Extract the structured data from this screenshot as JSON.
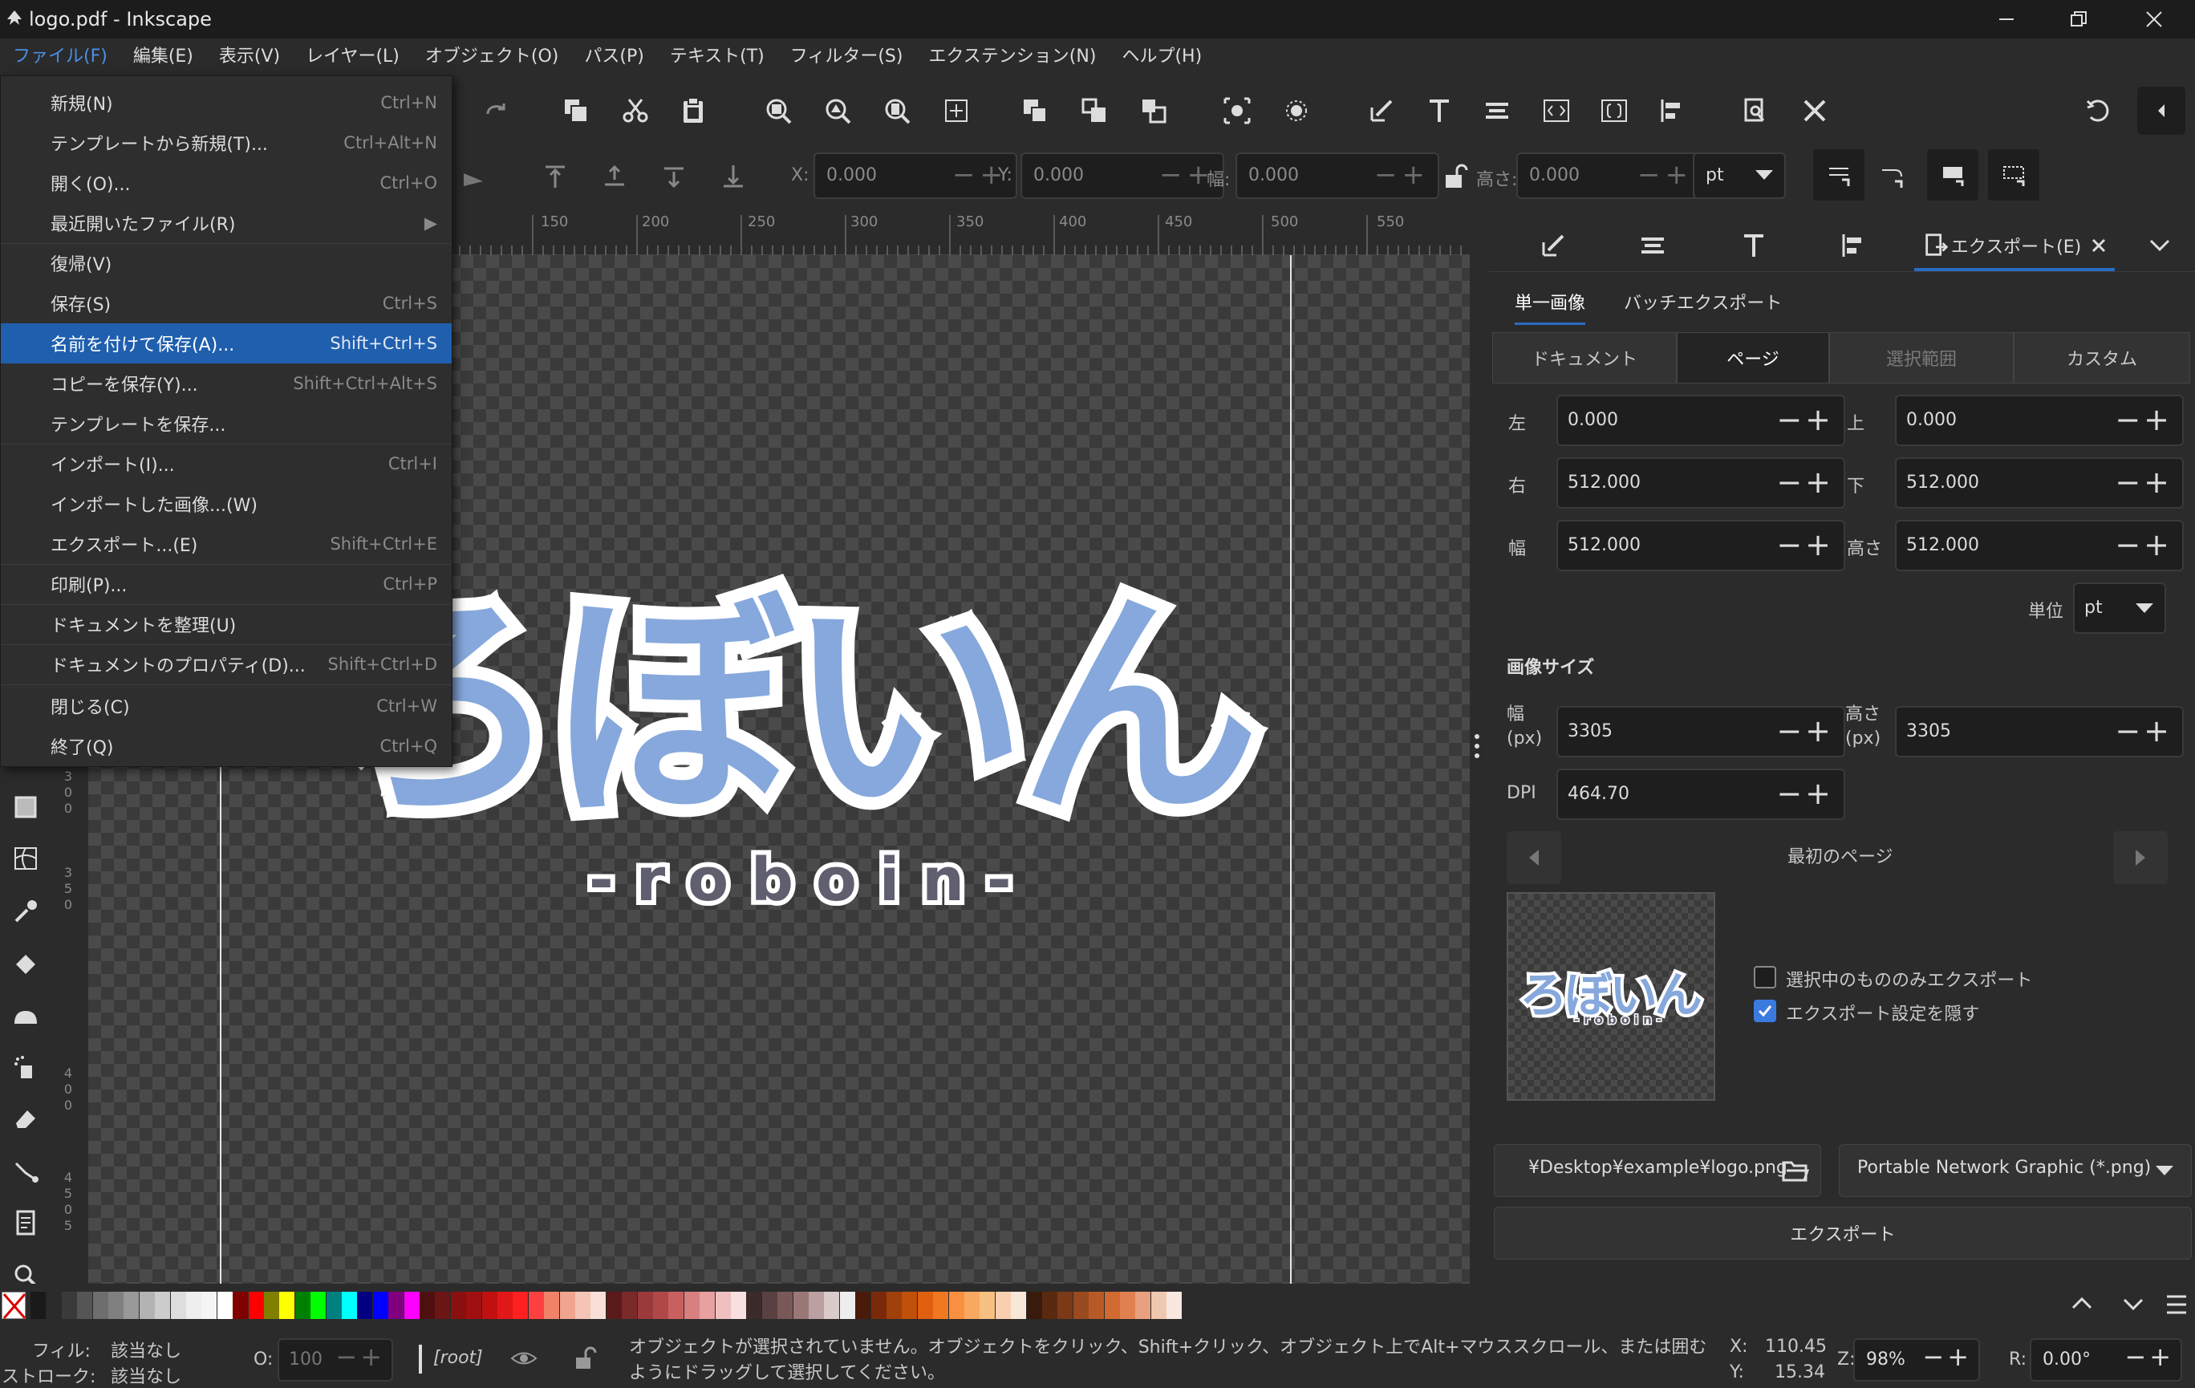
{
  "window": {
    "title": "logo.pdf - Inkscape"
  },
  "menubar": [
    "ファイル(F)",
    "編集(E)",
    "表示(V)",
    "レイヤー(L)",
    "オブジェクト(O)",
    "パス(P)",
    "テキスト(T)",
    "フィルター(S)",
    "エクステンション(N)",
    "ヘルプ(H)"
  ],
  "file_menu": [
    {
      "label": "新規(N)",
      "shortcut": "Ctrl+N"
    },
    {
      "label": "テンプレートから新規(T)...",
      "shortcut": "Ctrl+Alt+N"
    },
    {
      "label": "開く(O)...",
      "shortcut": "Ctrl+O"
    },
    {
      "label": "最近開いたファイル(R)",
      "shortcut": "▶"
    },
    {
      "label": "復帰(V)",
      "shortcut": ""
    },
    {
      "label": "保存(S)",
      "shortcut": "Ctrl+S"
    },
    {
      "label": "名前を付けて保存(A)...",
      "shortcut": "Shift+Ctrl+S"
    },
    {
      "label": "コピーを保存(Y)...",
      "shortcut": "Shift+Ctrl+Alt+S"
    },
    {
      "label": "テンプレートを保存...",
      "shortcut": ""
    },
    {
      "label": "インポート(I)...",
      "shortcut": "Ctrl+I"
    },
    {
      "label": "インポートした画像...(W)",
      "shortcut": ""
    },
    {
      "label": "エクスポート...(E)",
      "shortcut": "Shift+Ctrl+E"
    },
    {
      "label": "印刷(P)...",
      "shortcut": "Ctrl+P"
    },
    {
      "label": "ドキュメントを整理(U)",
      "shortcut": ""
    },
    {
      "label": "ドキュメントのプロパティ(D)...",
      "shortcut": "Shift+Ctrl+D"
    },
    {
      "label": "閉じる(C)",
      "shortcut": "Ctrl+W"
    },
    {
      "label": "終了(Q)",
      "shortcut": "Ctrl+Q"
    }
  ],
  "toolbar2": {
    "x_label": "X:",
    "x": "0.000",
    "y_label": "Y:",
    "y": "0.000",
    "w_label": "幅:",
    "w": "0.000",
    "h_label": "高さ:",
    "h": "0.000",
    "unit": "pt"
  },
  "ruler": [
    "150",
    "200",
    "250",
    "300",
    "350",
    "400",
    "450",
    "500",
    "550"
  ],
  "ruler_left": [
    "3",
    "0",
    "0",
    "3",
    "5",
    "0",
    "4",
    "0",
    "0",
    "4",
    "5",
    "0",
    "5"
  ],
  "logo": {
    "main": "ろぼいん",
    "sub": "-roboin-"
  },
  "export_panel": {
    "tab_label": "エクスポート(E)",
    "subtabs": [
      "単一画像",
      "バッチエクスポート"
    ],
    "areas": [
      "ドキュメント",
      "ページ",
      "選択範囲",
      "カスタム"
    ],
    "left_label": "左",
    "left": "0.000",
    "top_label": "上",
    "top": "0.000",
    "right_label": "右",
    "right": "512.000",
    "bottom_label": "下",
    "bottom": "512.000",
    "width_label": "幅",
    "width": "512.000",
    "height_label": "高さ",
    "height": "512.000",
    "unit_label": "単位",
    "unit": "pt",
    "image_size_title": "画像サイズ",
    "px_width_label": "幅\n(px)",
    "px_width": "3305",
    "px_height_label": "高さ\n(px)",
    "px_height": "3305",
    "dpi_label": "DPI",
    "dpi": "464.70",
    "page_nav": "最初のページ",
    "only_selected": "選択中のもののみエクスポート",
    "hide_settings": "エクスポート設定を隠す",
    "filename": "¥Desktop¥example¥logo.png",
    "format": "Portable Network Graphic (*.png)",
    "export_button": "エクスポート"
  },
  "status": {
    "fill_label": "フィル:",
    "fill": "該当なし",
    "stroke_label": "ストローク:",
    "stroke": "該当なし",
    "opacity_label": "O:",
    "opacity": "100",
    "layer": "[root]",
    "message": "オブジェクトが選択されていません。オブジェクトをクリック、Shift+クリック、オブジェクト上でAlt+マウススクロール、または囲むようにドラッグして選択してください。",
    "x_label": "X:",
    "x": "110.45",
    "y_label": "Y:",
    "y": "15.34",
    "zoom_label": "Z:",
    "zoom": "98%",
    "rotate_label": "R:",
    "rotate": "0.00°"
  },
  "palette_colors": [
    "#1a1a1a",
    "#2a2a2a",
    "#3a3a3a",
    "#555555",
    "#6e6e6e",
    "#808080",
    "#999999",
    "#b3b3b3",
    "#cccccc",
    "#dddddd",
    "#eeeeee",
    "#f5f5f5",
    "#ffffff",
    "#800000",
    "#ff0000",
    "#808000",
    "#ffff00",
    "#008000",
    "#00ff00",
    "#008080",
    "#00ffff",
    "#000080",
    "#0000ff",
    "#800080",
    "#ff00ff",
    "#4d0f0f",
    "#6b1515",
    "#8a1010",
    "#a01010",
    "#c01010",
    "#e01818",
    "#ff2020",
    "#ff4040",
    "#f0826a",
    "#f2a58e",
    "#f4c4b6",
    "#f8e0d8",
    "#5a1a1a",
    "#7a2a2a",
    "#9a3a3a",
    "#b04848",
    "#c86060",
    "#d88080",
    "#e8a0a0",
    "#f0c0c0",
    "#f8e0e0",
    "#3a2a2a",
    "#5a4040",
    "#7a5858",
    "#9a7878",
    "#baa0a0",
    "#dacaca",
    "#eeeeee",
    "#4a1a0a",
    "#7a2a0a",
    "#a0400a",
    "#c0500a",
    "#e06010",
    "#f07820",
    "#f89040",
    "#f8a860",
    "#f8c080",
    "#f8d0b0",
    "#f8e8d8",
    "#3a1a0a",
    "#5a2a10",
    "#7a3a18",
    "#9a4a20",
    "#b85a28",
    "#d06a30",
    "#e08050",
    "#e8a080",
    "#f0c8b0",
    "#f8e8e0"
  ]
}
